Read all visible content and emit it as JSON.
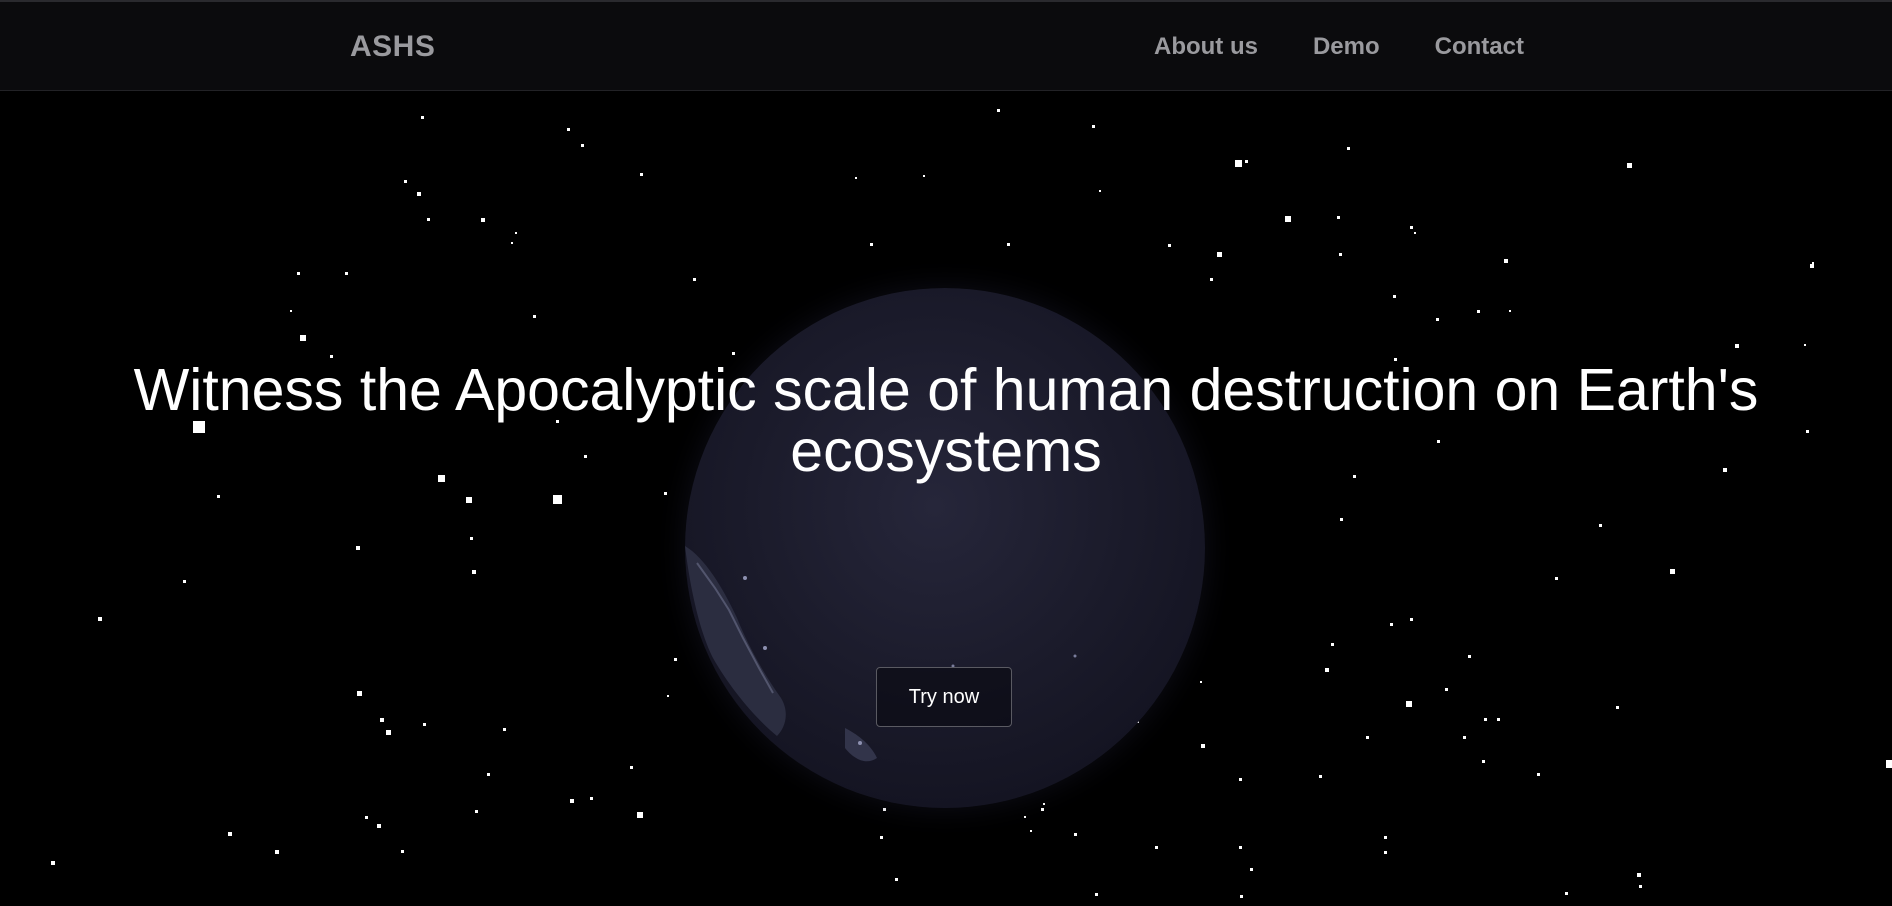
{
  "navbar": {
    "brand": "ASHS",
    "links": [
      {
        "label": "About us"
      },
      {
        "label": "Demo"
      },
      {
        "label": "Contact"
      }
    ]
  },
  "hero": {
    "headline_line1": "Witness the Apocalyptic scale of human destruction on Earth's",
    "headline_line2": "ecosystems",
    "cta_label": "Try now"
  },
  "colors": {
    "background": "#000000",
    "navbar_bg": "#0b0b0d",
    "nav_text": "#9a9a9e",
    "headline_text": "#ffffff",
    "globe": "#1b1b2b",
    "stars": "#ffffff"
  }
}
